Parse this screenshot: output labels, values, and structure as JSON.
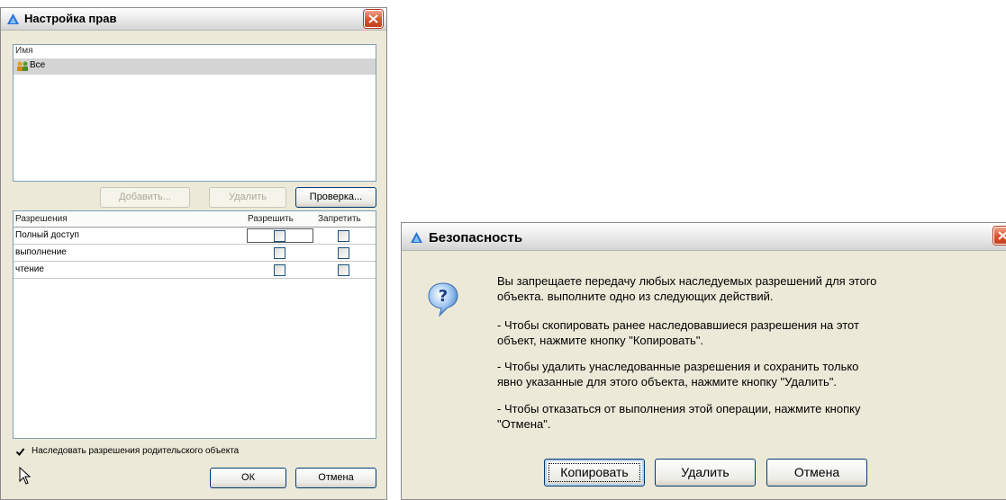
{
  "perm_dialog": {
    "title": "Настройка прав",
    "names": {
      "header": "Имя",
      "selected_user": "Все"
    },
    "buttons": {
      "add": "Добавить...",
      "remove": "Удалить",
      "check": "Проверка..."
    },
    "permissions": {
      "header_name": "Разрешения",
      "header_allow": "Разрешить",
      "header_deny": "Запретить",
      "rows": [
        "Полный доступ",
        "выполнение",
        "чтение"
      ]
    },
    "inherit_label": "Наследовать разрешения родительского объекта",
    "inherit_checked": true,
    "ok_label": "ОК",
    "cancel_label": "Отмена"
  },
  "security_dialog": {
    "title": "Безопасность",
    "message": {
      "line1": "Вы запрещаете передачу любых наследуемых разрешений для этого",
      "line2": "объекта. выполните одно из следующих действий.",
      "copy_line1": "- Чтобы скопировать ранее наследовавшиеся разрешения на этот",
      "copy_line2": "объект, нажмите кнопку \"Копировать\".",
      "remove_line1": "- Чтобы удалить унаследованные разрешения и сохранить только",
      "remove_line2": "явно указанные для этого объекта, нажмите кнопку \"Удалить\".",
      "cancel_line1": "- Чтобы отказаться от выполнения этой операции, нажмите кнопку",
      "cancel_line2": "\"Отмена\"."
    },
    "buttons": {
      "copy": "Копировать",
      "remove": "Удалить",
      "cancel": "Отмена"
    }
  },
  "icons": {
    "app": "app-logo-icon",
    "close": "close-icon",
    "users": "users-group-icon",
    "question": "question-icon",
    "checkmark": "checkmark-icon",
    "cursor": "mouse-cursor-icon"
  },
  "colors": {
    "close_red": "#d8512c",
    "dialog_bg": "#ece9d8",
    "selection": "#d4d4d4",
    "accent_blue": "#2a6fd6"
  }
}
